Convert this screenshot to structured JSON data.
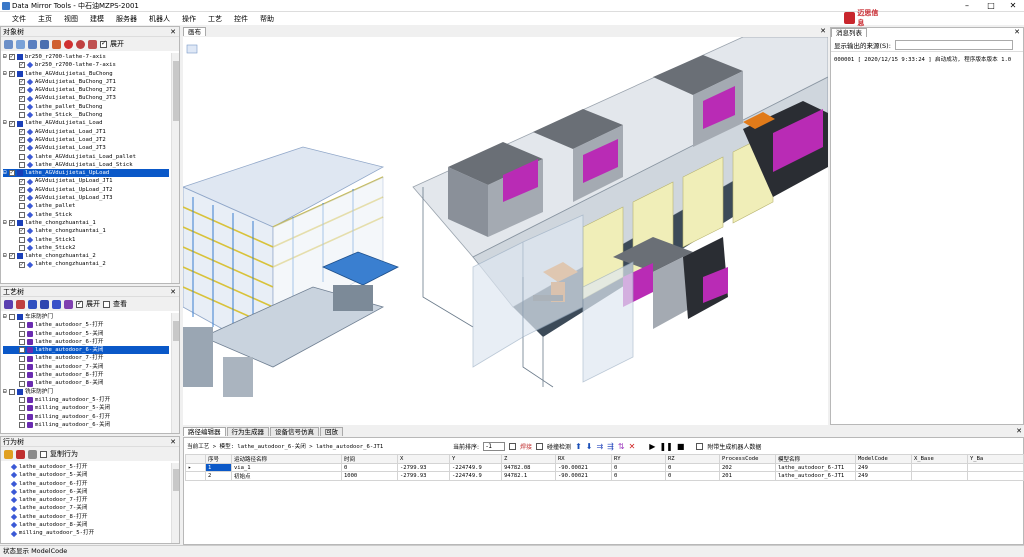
{
  "window": {
    "title": "Data Mirror Tools - 中石油MZPS-2001"
  },
  "menu": [
    "文件",
    "主页",
    "视图",
    "建模",
    "服务器",
    "机器人",
    "操作",
    "工艺",
    "控件",
    "帮助"
  ],
  "logo": {
    "text": "迈思信息"
  },
  "object_tree": {
    "title": "对象树",
    "expand_label": "展开",
    "rows": [
      {
        "indent": 0,
        "exp": "⊟",
        "check": true,
        "icon": "fld",
        "text": "br250_r2700-lathe-7-axis"
      },
      {
        "indent": 2,
        "exp": "",
        "check": true,
        "icon": "dia",
        "text": "br250_r2700-lathe-7-axis"
      },
      {
        "indent": 0,
        "exp": "⊟",
        "check": true,
        "icon": "fld",
        "text": "lathe_AGVduijietai_BuChong"
      },
      {
        "indent": 2,
        "exp": "",
        "check": true,
        "icon": "dia",
        "text": "AGVduijietai_BuChong_JT1"
      },
      {
        "indent": 2,
        "exp": "",
        "check": true,
        "icon": "dia",
        "text": "AGVduijietai_BuChong_JT2"
      },
      {
        "indent": 2,
        "exp": "",
        "check": true,
        "icon": "dia",
        "text": "AGVduijietai_BuChong_JT3"
      },
      {
        "indent": 2,
        "exp": "",
        "check": false,
        "icon": "dia",
        "text": "lathe_pallet_BuChong"
      },
      {
        "indent": 2,
        "exp": "",
        "check": false,
        "icon": "dia",
        "text": "lathe_Stick__BuChong"
      },
      {
        "indent": 0,
        "exp": "⊟",
        "check": true,
        "icon": "fld",
        "text": "lathe_AGVduijietai_Load"
      },
      {
        "indent": 2,
        "exp": "",
        "check": true,
        "icon": "dia",
        "text": "AGVduijietai_Load_JT1"
      },
      {
        "indent": 2,
        "exp": "",
        "check": true,
        "icon": "dia",
        "text": "AGVduijietai_Load_JT2"
      },
      {
        "indent": 2,
        "exp": "",
        "check": true,
        "icon": "dia",
        "text": "AGVduijietai_Load_JT3"
      },
      {
        "indent": 2,
        "exp": "",
        "check": false,
        "icon": "dia",
        "text": "lahte_AGVduijietai_Load_pallet"
      },
      {
        "indent": 2,
        "exp": "",
        "check": false,
        "icon": "dia",
        "text": "lathe_AGVduijietai_Load_Stick"
      },
      {
        "indent": 0,
        "exp": "⊟",
        "check": true,
        "icon": "fld",
        "text": "lathe_AGVduijietai_UpLoad",
        "selected": true
      },
      {
        "indent": 2,
        "exp": "",
        "check": true,
        "icon": "dia",
        "text": "AGVduijietai_UpLoad_JT1"
      },
      {
        "indent": 2,
        "exp": "",
        "check": true,
        "icon": "dia",
        "text": "AGVduijietai_UpLoad_JT2"
      },
      {
        "indent": 2,
        "exp": "",
        "check": true,
        "icon": "dia",
        "text": "AGVduijietai_UpLoad_JT3"
      },
      {
        "indent": 2,
        "exp": "",
        "check": false,
        "icon": "dia",
        "text": "lathe_pallet"
      },
      {
        "indent": 2,
        "exp": "",
        "check": false,
        "icon": "dia",
        "text": "lathe_Stick"
      },
      {
        "indent": 0,
        "exp": "⊟",
        "check": true,
        "icon": "fld",
        "text": "lathe_chongzhuantai_1"
      },
      {
        "indent": 2,
        "exp": "",
        "check": true,
        "icon": "dia",
        "text": "lahte_chongzhuantai_1"
      },
      {
        "indent": 2,
        "exp": "",
        "check": false,
        "icon": "dia",
        "text": "lathe_Stick1"
      },
      {
        "indent": 2,
        "exp": "",
        "check": false,
        "icon": "dia",
        "text": "lathe_Stick2"
      },
      {
        "indent": 0,
        "exp": "⊟",
        "check": true,
        "icon": "fld",
        "text": "lahte_chongzhuantai_2"
      },
      {
        "indent": 2,
        "exp": "",
        "check": true,
        "icon": "dia",
        "text": "lahte_chongzhuantai_2"
      }
    ]
  },
  "process_tree": {
    "title": "工艺树",
    "expand_label": "展开",
    "view_label": "查看",
    "rows": [
      {
        "indent": 0,
        "exp": "⊟",
        "check": false,
        "icon": "fld",
        "text": "车床防护门"
      },
      {
        "indent": 2,
        "exp": "",
        "check": false,
        "icon": "act",
        "text": "lathe_autodoor_5-打开"
      },
      {
        "indent": 2,
        "exp": "",
        "check": false,
        "icon": "act",
        "text": "lathe_autodoor_5-关闭"
      },
      {
        "indent": 2,
        "exp": "",
        "check": false,
        "icon": "act",
        "text": "lathe_autodoor_6-打开"
      },
      {
        "indent": 2,
        "exp": "",
        "check": false,
        "icon": "act",
        "text": "lathe_autodoor_6-关闭",
        "selected": true
      },
      {
        "indent": 2,
        "exp": "",
        "check": false,
        "icon": "act",
        "text": "lathe_autodoor_7-打开"
      },
      {
        "indent": 2,
        "exp": "",
        "check": false,
        "icon": "act",
        "text": "lathe_autodoor_7-关闭"
      },
      {
        "indent": 2,
        "exp": "",
        "check": false,
        "icon": "act",
        "text": "lathe_autodoor_8-打开"
      },
      {
        "indent": 2,
        "exp": "",
        "check": false,
        "icon": "act",
        "text": "lathe_autodoor_8-关闭"
      },
      {
        "indent": 0,
        "exp": "⊟",
        "check": false,
        "icon": "fld",
        "text": "铣床防护门"
      },
      {
        "indent": 2,
        "exp": "",
        "check": false,
        "icon": "act",
        "text": "milling_autodoor_5-打开"
      },
      {
        "indent": 2,
        "exp": "",
        "check": false,
        "icon": "act",
        "text": "milling_autodoor_5-关闭"
      },
      {
        "indent": 2,
        "exp": "",
        "check": false,
        "icon": "act",
        "text": "milling_autodoor_6-打开"
      },
      {
        "indent": 2,
        "exp": "",
        "check": false,
        "icon": "act",
        "text": "milling_autodoor_6-关闭"
      }
    ]
  },
  "action_tree": {
    "title": "行为树",
    "copy_label": "复制行为",
    "rows": [
      {
        "text": "lathe_autodoor_5-打开"
      },
      {
        "text": "lathe_autodoor_5-关闭"
      },
      {
        "text": "lathe_autodoor_6-打开"
      },
      {
        "text": "lathe_autodoor_6-关闭"
      },
      {
        "text": "lathe_autodoor_7-打开"
      },
      {
        "text": "lathe_autodoor_7-关闭"
      },
      {
        "text": "lathe_autodoor_8-打开"
      },
      {
        "text": "lathe_autodoor_8-关闭"
      },
      {
        "text": "milling_autodoor_5-打开"
      }
    ]
  },
  "scene": {
    "tab": "画布"
  },
  "messages": {
    "tab": "消息列表",
    "filter_label": "显示输出的来源(S):",
    "lines": [
      "000001 [ 2020/12/15 9:33:24 ]  启动成功, 程序版本版本 1.0"
    ]
  },
  "bottom": {
    "tabs": [
      "路径编辑器",
      "行为生成器",
      "设备信号仿真",
      "回放"
    ],
    "breadcrumb": "当前工艺 > 模型: lathe_autodoor_6-关闭 > lathe_autodoor_6-JT1",
    "order_label": "当前排序:",
    "order_value": "-1",
    "weld_label": "焊接",
    "ctrl_label": "碰撞检测",
    "gen_label": "附带生成机器人数据",
    "columns": [
      "",
      "序号",
      "运动路径名称",
      "时间",
      "X",
      "Y",
      "Z",
      "RX",
      "RY",
      "RZ",
      "ProcessCode",
      "模型名称",
      "ModelCode",
      "X_Base",
      "Y_Ba"
    ],
    "rows": [
      [
        "▸",
        "1",
        "via_1",
        "0",
        "-2799.93",
        "-224749.9",
        "94782.08",
        "-90.00021",
        "0",
        "0",
        "202",
        "lathe_autodoor_6-JT1",
        "249",
        "",
        ""
      ],
      [
        "",
        "2",
        "初始点",
        "1000",
        "-2799.93",
        "-224749.9",
        "94782.1",
        "-90.00021",
        "0",
        "0",
        "201",
        "lathe_autodoor_6-JT1",
        "249",
        "",
        ""
      ]
    ]
  },
  "status": {
    "text": "状态显示  ModelCode"
  }
}
